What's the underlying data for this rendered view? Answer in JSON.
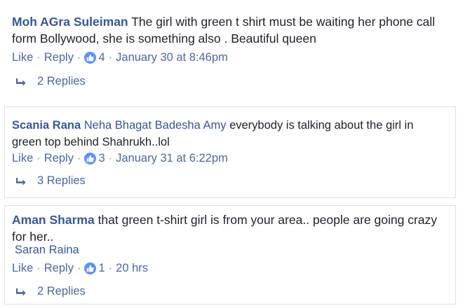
{
  "comments": [
    {
      "author": "Moh AGra Suleiman",
      "mention": "",
      "text": "The girl with green t shirt must be waiting her phone call form Bollywood, she is something also . Beautiful queen",
      "reply_to": "",
      "like_label": "Like",
      "reply_label": "Reply",
      "like_count": "4",
      "timestamp": "January 30 at 8:46pm",
      "replies_label": "2 Replies"
    },
    {
      "author": "Scania Rana",
      "mention": "Neha Bhagat Badesha Amy",
      "text": "everybody is talking about the girl in green top behind Shahrukh..lol",
      "reply_to": "",
      "like_label": "Like",
      "reply_label": "Reply",
      "like_count": "3",
      "timestamp": "January 31 at 6:22pm",
      "replies_label": "3 Replies"
    },
    {
      "author": "Aman Sharma",
      "mention": "",
      "text": "that green t-shirt girl is from your area.. people are going crazy for her..",
      "reply_to": "Saran Raina",
      "like_label": "Like",
      "reply_label": "Reply",
      "like_count": "1",
      "timestamp": "20 hrs",
      "replies_label": "2 Replies"
    }
  ],
  "colors": {
    "author": "#365899",
    "meta": "#90949c",
    "like_badge": "#5890ff",
    "border": "#dddfe2"
  },
  "icons": {
    "like_badge": "thumbs-up-icon",
    "replies": "reply-arrow-icon"
  }
}
